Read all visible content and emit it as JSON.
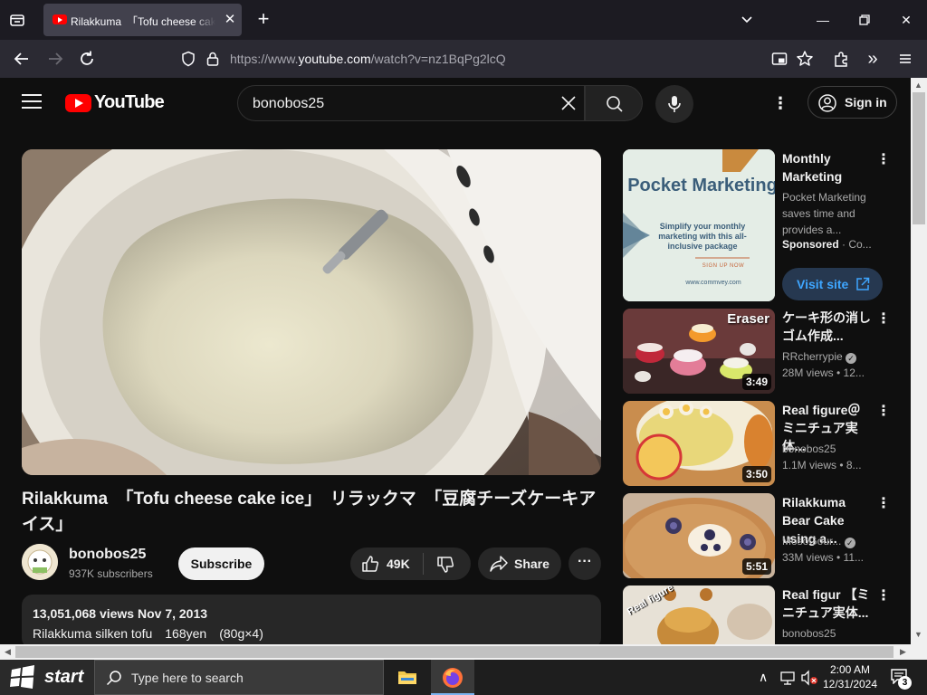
{
  "browser": {
    "tab_title": "Rilakkuma　「Tofu cheese cake ice」",
    "url_prefix": "https://www.",
    "url_domain": "youtube.com",
    "url_path": "/watch?v=nz1BqPg2lcQ"
  },
  "youtube": {
    "logo_text": "YouTube",
    "search_query": "bonobos25",
    "sign_in": "Sign in"
  },
  "video": {
    "title": "Rilakkuma　「Tofu cheese cake ice」　リラックマ　「豆腐チーズケーキアイス」",
    "channel": "bonobos25",
    "subscribers": "937K subscribers",
    "subscribe_label": "Subscribe",
    "likes": "49K",
    "share_label": "Share",
    "stats": "13,051,068 views  Nov 7, 2013",
    "description_line": "Rilakkuma silken tofu　168yen　(80g×4)"
  },
  "ad": {
    "thumb_title": "Pocket Marketing",
    "thumb_sub": "Simplify your monthly marketing with this all-inclusive package",
    "thumb_cta": "SIGN UP NOW",
    "thumb_url": "www.commvey.com",
    "title": "Monthly Marketing",
    "description": "Pocket Marketing saves time and provides a...",
    "sponsored": "Sponsored",
    "sponsor_suffix": " · Co...",
    "visit_label": "Visit site"
  },
  "related": [
    {
      "title": "ケーキ形の消しゴム作成...",
      "channel": "RRcherrypie",
      "meta": "28M views  • 12...",
      "duration": "3:49",
      "thumb_label": "Eraser"
    },
    {
      "title": "Real figure＠ミニチュア実体...",
      "channel": "bonobos25",
      "meta": "1.1M views  • 8...",
      "duration": "3:50"
    },
    {
      "title": "Rilakkuma Bear Cake using a...",
      "channel": "MosoGour...",
      "meta": "33M views  • 11...",
      "duration": "5:51"
    },
    {
      "title": "Real figur 【ミニチュア実体...",
      "channel": "bonobos25",
      "meta": "",
      "duration": "",
      "thumb_label": "Real figure"
    }
  ],
  "taskbar": {
    "start_label": "start",
    "search_placeholder": "Type here to search",
    "time": "2:00 AM",
    "date": "12/31/2024",
    "notification_count": "3"
  },
  "colors": {
    "youtube_red": "#ff0000",
    "page_bg": "#0f0f0f",
    "ad_bg": "#e4ede6",
    "visit_site_bg": "#263850",
    "visit_site_fg": "#3ea6ff"
  }
}
